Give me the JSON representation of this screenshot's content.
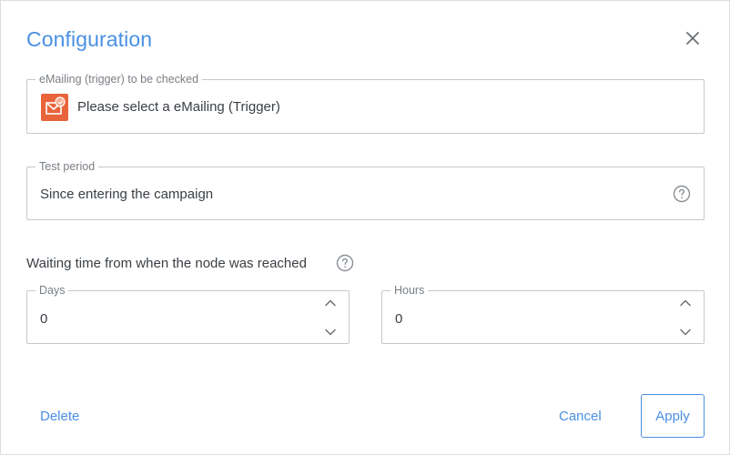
{
  "dialog": {
    "title": "Configuration"
  },
  "mailing_field": {
    "legend": "eMailing (trigger) to be checked",
    "value": "Please select a eMailing (Trigger)",
    "icon": "mailing-icon",
    "icon_color": "#e8643a"
  },
  "period_field": {
    "legend": "Test period",
    "value": "Since entering the campaign",
    "icon": "help-icon"
  },
  "waiting": {
    "label": "Waiting time from when the node was reached",
    "icon": "help-icon",
    "days": {
      "legend": "Days",
      "value": "0"
    },
    "hours": {
      "legend": "Hours",
      "value": "0"
    }
  },
  "footer": {
    "delete_label": "Delete",
    "cancel_label": "Cancel",
    "apply_label": "Apply"
  },
  "colors": {
    "accent": "#4a90e2",
    "border": "#c4c8cc",
    "text": "#3a3f45",
    "legend": "#7a7f85"
  }
}
